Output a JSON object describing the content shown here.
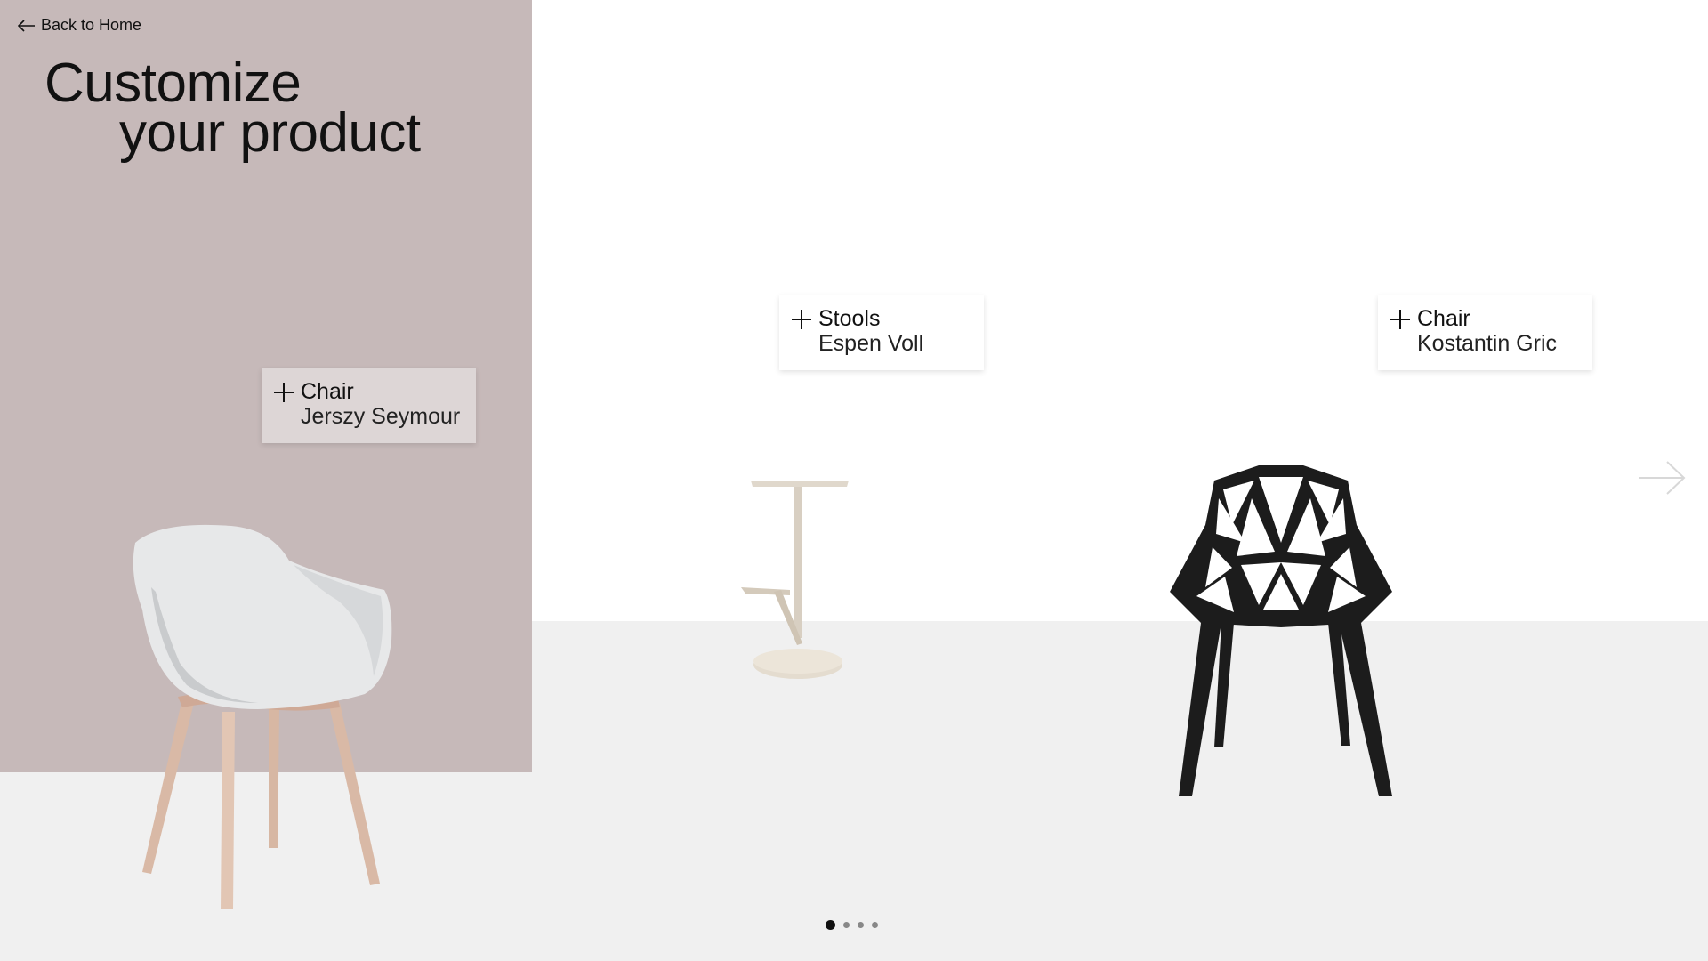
{
  "nav": {
    "back_label": "Back to Home",
    "back_icon": "arrow-left-icon"
  },
  "hero": {
    "title_line1": "Customize",
    "title_line2": "your product"
  },
  "products": [
    {
      "category": "Chair",
      "designer": "Jerszy Seymour",
      "icon": "plus-icon"
    },
    {
      "category": "Stools",
      "designer": "Espen Voll",
      "icon": "plus-icon"
    },
    {
      "category": "Chair",
      "designer": "Kostantin Gric",
      "icon": "plus-icon"
    }
  ],
  "carousel": {
    "next_icon": "arrow-right-icon",
    "page_count": 4,
    "active_index": 0
  },
  "colors": {
    "left_panel": "#c6b9b9",
    "floor": "#f0f0f0",
    "background": "#ffffff"
  }
}
